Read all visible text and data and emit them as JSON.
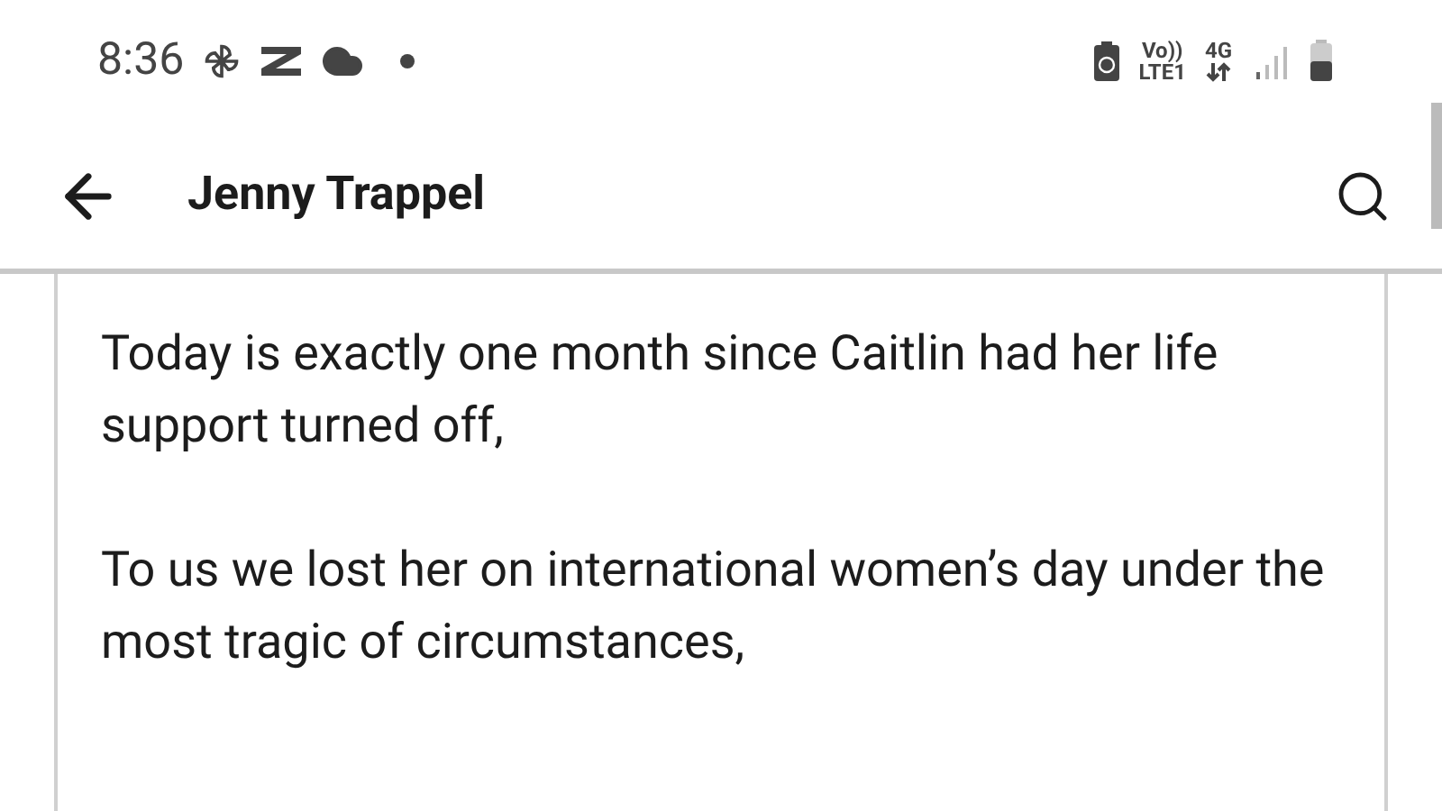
{
  "status_bar": {
    "time": "8:36",
    "volte": "Vo))",
    "lte": "LTE1",
    "network": "4G"
  },
  "header": {
    "title": "Jenny Trappel"
  },
  "post": {
    "paragraphs": [
      "Today is exactly one month since Caitlin had her life support turned off,",
      "To us we lost her on international women’s day under the most tragic of circumstances,"
    ]
  }
}
